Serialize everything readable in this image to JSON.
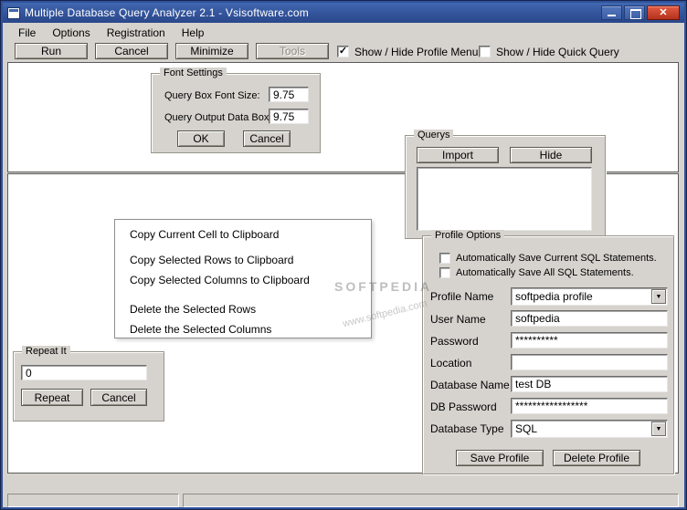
{
  "window": {
    "title": "Multiple Database Query Analyzer 2.1 - Vsisoftware.com"
  },
  "icons": {
    "close": "✕",
    "check": "✓",
    "dropdown": "▼"
  },
  "menu": {
    "items": [
      "File",
      "Options",
      "Registration",
      "Help"
    ]
  },
  "toolbar": {
    "run": "Run",
    "cancel": "Cancel",
    "minimize": "Minimize",
    "tools": "Tools",
    "profile_menu_checkbox": {
      "label": "Show / Hide Profile Menu",
      "checked": true
    },
    "quick_query_checkbox": {
      "label": "Show / Hide Quick Query",
      "checked": false
    }
  },
  "font_settings": {
    "title": "Font Settings",
    "query_box_label": "Query Box Font Size:",
    "query_box_value": "9.75",
    "output_box_label": "Query Output Data Box:",
    "output_box_value": "9.75",
    "ok": "OK",
    "cancel": "Cancel"
  },
  "querys": {
    "title": "Querys",
    "import": "Import",
    "hide": "Hide"
  },
  "context_menu": {
    "items": [
      "Copy Current Cell to Clipboard",
      "Copy Selected Rows to Clipboard",
      "Copy Selected Columns to Clipboard",
      "Delete the Selected Rows",
      "Delete the Selected Columns"
    ]
  },
  "profile_options": {
    "title": "Profile Options",
    "checkboxes": [
      {
        "label": "Automatically Save Current SQL Statements.",
        "checked": false
      },
      {
        "label": "Automatically Save All SQL Statements.",
        "checked": false
      }
    ],
    "profile_name": {
      "label": "Profile Name",
      "value": "softpedia profile"
    },
    "user_name": {
      "label": "User Name",
      "value": "softpedia"
    },
    "password": {
      "label": "Password",
      "value": "**********"
    },
    "location": {
      "label": "Location",
      "value": ""
    },
    "database_name": {
      "label": "Database Name",
      "value": "test DB"
    },
    "db_password": {
      "label": "DB Password",
      "value": "*****************"
    },
    "database_type": {
      "label": "Database Type",
      "value": "SQL"
    },
    "save_button": "Save Profile",
    "delete_button": "Delete Profile"
  },
  "repeat_it": {
    "title": "Repeat It",
    "value": "0",
    "repeat": "Repeat",
    "cancel": "Cancel"
  },
  "watermark": {
    "line1": "SOFTPEDIA",
    "line2": "www.softpedia.com"
  }
}
